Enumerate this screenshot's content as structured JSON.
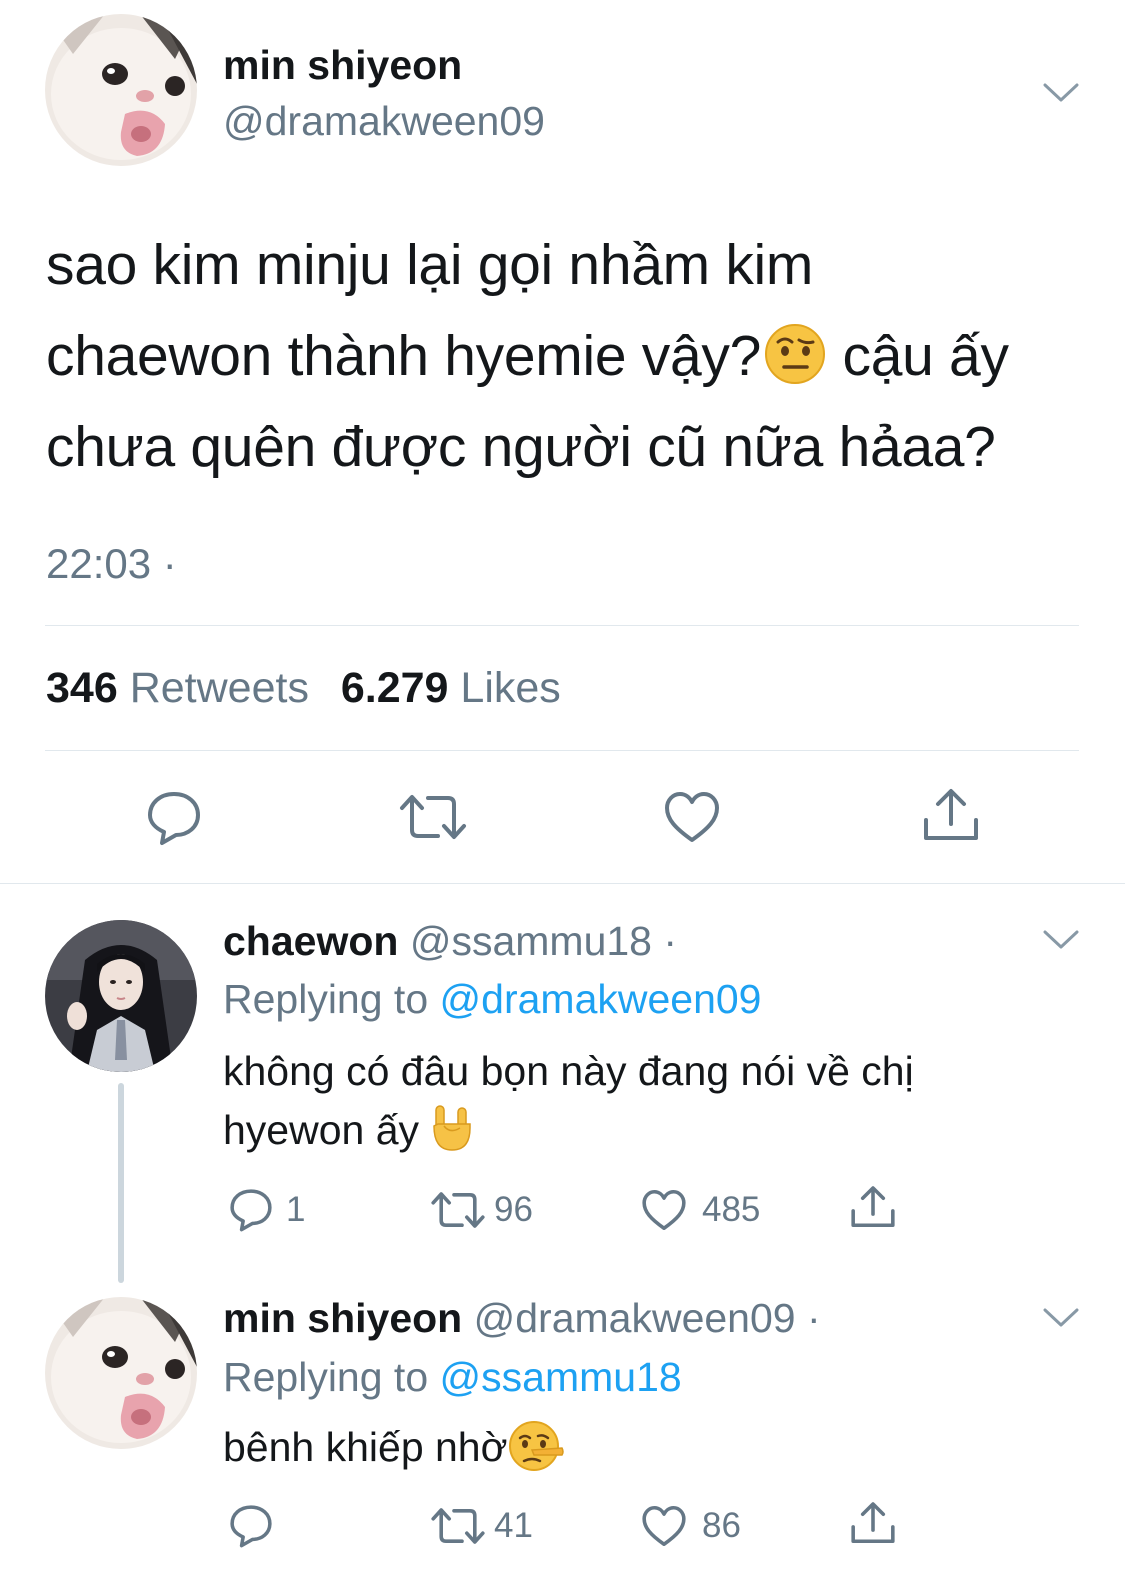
{
  "main_tweet": {
    "name": "min shiyeon",
    "handle": "@dramakween09",
    "text_line1": "sao kim minju lại gọi nhầm kim",
    "text_line2a": "chaewon thành hyemie vậy?",
    "text_line2b": " cậu ấy",
    "text_line3": "chưa quên được người cũ nữa hảaa?",
    "text_emoji": "face-with-raised-eyebrow",
    "time": "22:03 ·",
    "retweets_count": "346",
    "retweets_label": "Retweets",
    "likes_count": "6.279",
    "likes_label": "Likes",
    "actions": [
      "reply-icon",
      "retweet-icon",
      "like-icon",
      "share-icon"
    ]
  },
  "replies": [
    {
      "name": "chaewon",
      "handle": "@ssammu18 ·",
      "replying_prefix": "Replying to",
      "replying_to": "@dramakween09",
      "text_line1": "không có đâu bọn này đang nói về chị",
      "text_line2": "hyewon ấy",
      "text_emoji": "sign-of-the-horns",
      "reply_count": "1",
      "retweet_count": "96",
      "like_count": "485"
    },
    {
      "name": "min shiyeon",
      "handle": "@dramakween09 ·",
      "replying_prefix": "Replying to",
      "replying_to": "@ssammu18",
      "text_line1": "bênh khiếp nhờ",
      "text_emoji": "lying-face",
      "reply_count": "",
      "retweet_count": "41",
      "like_count": "86"
    }
  ],
  "colors": {
    "text": "#14171a",
    "secondary": "#657786",
    "link": "#1da1f2",
    "divider": "#e1e8ed"
  }
}
